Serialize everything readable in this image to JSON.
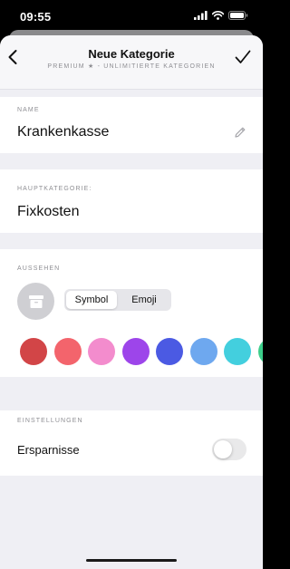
{
  "status_bar": {
    "time": "09:55"
  },
  "nav": {
    "title": "Neue Kategorie",
    "subtitle": "PREMIUM ★ - UNLIMITIERTE KATEGORIEN"
  },
  "name_section": {
    "label": "NAME",
    "value": "Krankenkasse"
  },
  "hauptkategorie_section": {
    "label": "HAUPTKATEGORIE:",
    "value": "Fixkosten"
  },
  "aussehen_section": {
    "label": "AUSSEHEN",
    "icon": "archive-box-icon",
    "segments": [
      "Symbol",
      "Emoji"
    ],
    "selected_segment": "Symbol",
    "colors": [
      "#d24547",
      "#f3646c",
      "#f38ccd",
      "#9d45ea",
      "#4b5ae3",
      "#6ea8ef",
      "#43cfde",
      "#3cce8a"
    ]
  },
  "einstellungen_section": {
    "label": "EINSTELLUNGEN",
    "ersparnisse_label": "Ersparnisse",
    "ersparnisse_enabled": false
  }
}
